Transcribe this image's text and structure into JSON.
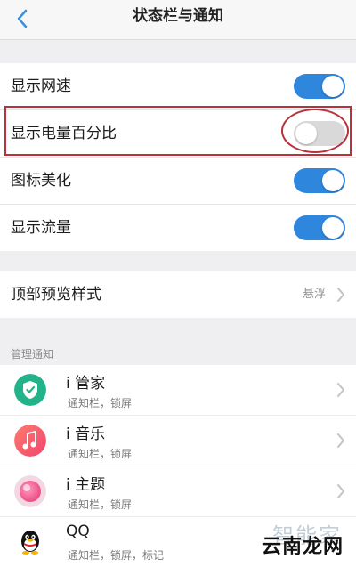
{
  "header": {
    "title": "状态栏与通知"
  },
  "toggles": [
    {
      "label": "显示网速",
      "state": "on"
    },
    {
      "label": "显示电量百分比",
      "state": "off"
    },
    {
      "label": "图标美化",
      "state": "on"
    },
    {
      "label": "显示流量",
      "state": "on"
    }
  ],
  "preview": {
    "label": "顶部预览样式",
    "value": "悬浮"
  },
  "notifications": {
    "section_title": "管理通知",
    "apps": [
      {
        "name": "i 管家",
        "sub": "通知栏，锁屏",
        "icon": "shield-icon"
      },
      {
        "name": "i 音乐",
        "sub": "通知栏，锁屏",
        "icon": "music-note-icon"
      },
      {
        "name": "i 主题",
        "sub": "通知栏，锁屏",
        "icon": "theme-icon"
      },
      {
        "name": "QQ",
        "sub": "通知栏，锁屏，标记",
        "icon": "qq-penguin-icon"
      }
    ]
  },
  "watermark": {
    "top": "智能家",
    "bottom": "云南龙网"
  },
  "colors": {
    "switch_on": "#2f86dd",
    "switch_off": "#d9d9d9",
    "highlight": "#b8323c"
  }
}
